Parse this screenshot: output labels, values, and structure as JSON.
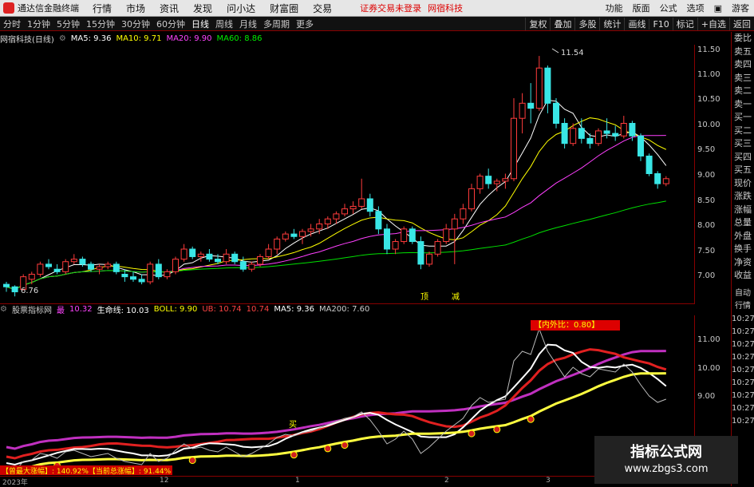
{
  "titlebar": {
    "app": "通达信金融终端",
    "menus": [
      "行情",
      "市场",
      "资讯",
      "发现",
      "问小达",
      "财富圈",
      "交易"
    ],
    "warn": "证券交易未登录",
    "warn2": "网宿科技",
    "right": [
      "功能",
      "版面",
      "公式",
      "选项",
      "▣",
      "游客"
    ]
  },
  "periods": [
    "分时",
    "1分钟",
    "5分钟",
    "15分钟",
    "30分钟",
    "60分钟",
    "日线",
    "周线",
    "月线",
    "多周期",
    "更多"
  ],
  "toolbar_right": [
    "复权",
    "叠加",
    "多股",
    "统计",
    "画线",
    "F10",
    "标记",
    "+自选",
    "返回"
  ],
  "stock": {
    "name": "网宿科技(日线)",
    "ma5": "MA5: 9.36",
    "ma10": "MA10: 9.71",
    "ma20": "MA20: 9.90",
    "ma60": "MA60: 8.86",
    "high_label": "11.54",
    "low_label": "6.76",
    "signal_1": "顶",
    "signal_2": "减"
  },
  "indicator": {
    "name": "股票指标网",
    "k1": "最",
    "v1": "10.32",
    "k2": "生命线: 10.03",
    "k3": "BOLL: 9.90",
    "k4": "UB: 10.74",
    "v4": "10.74",
    "k5": "MA5: 9.36",
    "k6": "MA200: 7.60",
    "ratio": "【内外比：0.80】",
    "buy_label": "买",
    "stats": "【曾最大涨幅】: 140.92%【当前总涨幅】: 91.44%"
  },
  "yaxis_main": [
    "11.50",
    "11.00",
    "10.50",
    "10.00",
    "9.50",
    "9.00",
    "8.50",
    "8.00",
    "7.50",
    "7.00"
  ],
  "yaxis_sub": [
    "11.00",
    "10.00",
    "9.00"
  ],
  "time_labels": [
    "2023年",
    "12",
    "1",
    "2",
    "3"
  ],
  "right_panel": [
    "委比",
    "卖五",
    "卖四",
    "卖三",
    "卖二",
    "卖一",
    "买一",
    "买二",
    "买三",
    "买四",
    "买五",
    "现价",
    "涨跌",
    "涨幅",
    "总量",
    "外盘",
    "换手",
    "净资",
    "收益"
  ],
  "right_panel_lower": [
    "自动",
    "行情",
    "10:27",
    "10:27",
    "10:27",
    "10:27",
    "10:27",
    "10:27",
    "10:27",
    "10:27",
    "10:27"
  ],
  "watermark": {
    "line1": "指标公式网",
    "line2": "www.zbgs3.com"
  },
  "colors": {
    "up": "#ff3b3b",
    "down": "#39e6e6",
    "ma5": "#ffffff",
    "ma10": "#ffff00",
    "ma20": "#ff40ff",
    "ma60": "#00e000"
  },
  "chart_data": {
    "type": "candlestick",
    "ylim": [
      6.7,
      11.7
    ],
    "candles": [
      [
        7.0,
        7.05,
        6.85,
        6.95
      ],
      [
        6.95,
        6.98,
        6.76,
        6.85
      ],
      [
        6.9,
        7.2,
        6.88,
        7.15
      ],
      [
        7.1,
        7.25,
        7.0,
        7.2
      ],
      [
        7.2,
        7.45,
        7.15,
        7.4
      ],
      [
        7.4,
        7.5,
        7.3,
        7.35
      ],
      [
        7.3,
        7.4,
        7.2,
        7.25
      ],
      [
        7.25,
        7.5,
        7.2,
        7.45
      ],
      [
        7.45,
        7.6,
        7.4,
        7.5
      ],
      [
        7.5,
        7.55,
        7.35,
        7.4
      ],
      [
        7.4,
        7.45,
        7.25,
        7.3
      ],
      [
        7.3,
        7.4,
        7.2,
        7.35
      ],
      [
        7.35,
        7.45,
        7.3,
        7.4
      ],
      [
        7.4,
        7.45,
        7.2,
        7.25
      ],
      [
        7.2,
        7.3,
        7.05,
        7.15
      ],
      [
        7.15,
        7.25,
        7.05,
        7.1
      ],
      [
        7.1,
        7.2,
        7.0,
        7.05
      ],
      [
        7.05,
        7.45,
        7.0,
        7.4
      ],
      [
        7.4,
        7.5,
        7.1,
        7.15
      ],
      [
        7.15,
        7.3,
        7.1,
        7.25
      ],
      [
        7.25,
        7.55,
        7.2,
        7.5
      ],
      [
        7.5,
        7.8,
        7.45,
        7.7
      ],
      [
        7.7,
        7.75,
        7.5,
        7.55
      ],
      [
        7.55,
        7.65,
        7.45,
        7.6
      ],
      [
        7.6,
        7.7,
        7.45,
        7.5
      ],
      [
        7.5,
        7.6,
        7.4,
        7.45
      ],
      [
        7.45,
        7.7,
        7.4,
        7.6
      ],
      [
        7.6,
        7.65,
        7.4,
        7.45
      ],
      [
        7.45,
        7.55,
        7.25,
        7.3
      ],
      [
        7.3,
        7.45,
        7.25,
        7.4
      ],
      [
        7.4,
        7.6,
        7.35,
        7.55
      ],
      [
        7.55,
        7.8,
        7.5,
        7.7
      ],
      [
        7.7,
        7.95,
        7.6,
        7.9
      ],
      [
        7.9,
        8.05,
        7.85,
        8.0
      ],
      [
        8.0,
        8.1,
        7.9,
        7.95
      ],
      [
        7.95,
        8.1,
        7.8,
        8.05
      ],
      [
        8.05,
        8.2,
        7.95,
        8.1
      ],
      [
        8.1,
        8.3,
        8.0,
        8.2
      ],
      [
        8.2,
        8.35,
        8.1,
        8.3
      ],
      [
        8.3,
        8.45,
        8.2,
        8.4
      ],
      [
        8.4,
        8.6,
        8.35,
        8.5
      ],
      [
        8.5,
        8.65,
        8.4,
        8.55
      ],
      [
        8.55,
        9.1,
        8.5,
        8.7
      ],
      [
        8.7,
        8.8,
        8.35,
        8.45
      ],
      [
        8.45,
        8.55,
        8.0,
        8.1
      ],
      [
        8.1,
        8.2,
        7.6,
        7.7
      ],
      [
        7.7,
        7.9,
        7.6,
        7.85
      ],
      [
        7.85,
        8.15,
        7.8,
        8.1
      ],
      [
        8.1,
        8.15,
        7.8,
        7.85
      ],
      [
        7.85,
        7.95,
        7.3,
        7.4
      ],
      [
        7.4,
        7.65,
        7.35,
        7.6
      ],
      [
        7.6,
        7.9,
        7.55,
        7.85
      ],
      [
        7.85,
        8.2,
        7.8,
        8.1
      ],
      [
        8.1,
        8.4,
        7.4,
        8.3
      ],
      [
        8.3,
        8.6,
        8.2,
        8.5
      ],
      [
        8.5,
        9.0,
        8.45,
        8.9
      ],
      [
        8.9,
        9.2,
        8.8,
        9.15
      ],
      [
        9.15,
        9.3,
        8.9,
        9.0
      ],
      [
        9.0,
        9.1,
        8.85,
        9.05
      ],
      [
        9.05,
        9.2,
        8.9,
        9.1
      ],
      [
        9.1,
        10.7,
        9.05,
        10.3
      ],
      [
        10.3,
        10.8,
        10.0,
        10.6
      ],
      [
        10.6,
        11.0,
        10.2,
        10.5
      ],
      [
        10.5,
        11.54,
        10.45,
        11.3
      ],
      [
        11.3,
        11.35,
        10.4,
        10.6
      ],
      [
        10.6,
        10.7,
        10.1,
        10.2
      ],
      [
        10.2,
        10.3,
        9.7,
        9.8
      ],
      [
        9.8,
        10.2,
        9.75,
        10.1
      ],
      [
        10.1,
        10.3,
        9.8,
        9.9
      ],
      [
        9.9,
        10.0,
        9.7,
        9.8
      ],
      [
        9.8,
        10.1,
        9.75,
        10.05
      ],
      [
        10.05,
        10.3,
        9.9,
        10.0
      ],
      [
        10.0,
        10.15,
        9.85,
        9.95
      ],
      [
        9.95,
        10.35,
        9.9,
        10.2
      ],
      [
        10.2,
        10.25,
        9.85,
        9.95
      ],
      [
        9.95,
        10.0,
        9.45,
        9.55
      ],
      [
        9.55,
        9.6,
        9.15,
        9.2
      ],
      [
        9.2,
        9.25,
        8.9,
        9.0
      ],
      [
        9.0,
        9.15,
        8.95,
        9.1
      ]
    ]
  }
}
